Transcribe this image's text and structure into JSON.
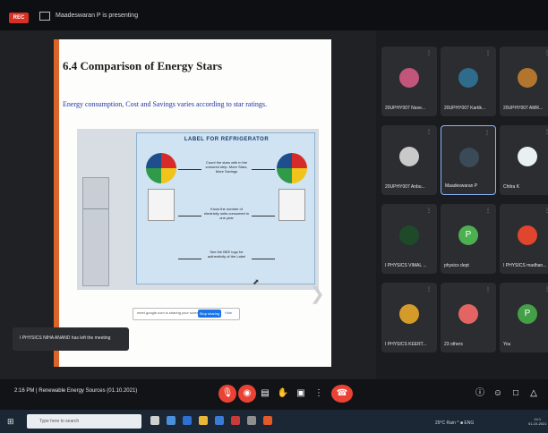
{
  "top": {
    "rec": "REC",
    "presenting": "Maadeswaran P is presenting"
  },
  "slide": {
    "title": "6.4 Comparison of Energy Stars",
    "subtitle": "Energy consumption, Cost and Savings varies according to star ratings.",
    "label_heading": "LABEL FOR REFRIGERATOR",
    "note1": "Count the stars with in the coloured strip. More Stars, More Savings",
    "note2": "Know the number of electricity units consumed in one year",
    "note3": "See the BEE logo for authenticity of the Label"
  },
  "share_bar": {
    "text": "meet.google.com is sharing your screen.",
    "stop": "Stop sharing",
    "hide": "Hide"
  },
  "toast": "I PHYSICS NIHA ANAND has left the meeting",
  "participants": [
    {
      "name": "20UPHY007 Nave...",
      "initial": "",
      "color": "#c2567a"
    },
    {
      "name": "20UPHY007 Kartik...",
      "initial": "",
      "color": "#2f6c8c"
    },
    {
      "name": "20UPHY007 AMR...",
      "initial": "",
      "color": "#b2752e"
    },
    {
      "name": "20UPHY007 Anbu...",
      "initial": "",
      "color": "#c9c9c9"
    },
    {
      "name": "Maadeswaran P",
      "initial": "",
      "color": "#3a4a56"
    },
    {
      "name": "Chitra K",
      "initial": "",
      "color": "#e8f0f4"
    },
    {
      "name": "I PHYSICS VIMAL ...",
      "initial": "",
      "color": "#1e4a2a"
    },
    {
      "name": "physics dept",
      "initial": "P",
      "color": "#4caf50"
    },
    {
      "name": "I PHYSICS madhan...",
      "initial": "",
      "color": "#e0452d"
    },
    {
      "name": "I PHYSICS KEERT...",
      "initial": "",
      "color": "#d59b2a"
    },
    {
      "name": "23 others",
      "initial": "",
      "color": "#e46464"
    },
    {
      "name": "You",
      "initial": "P",
      "color": "#43a047"
    }
  ],
  "bottom": {
    "time_label": "2:16 PM | Renewable Energy Sources (01.10.2021)"
  },
  "taskbar": {
    "search": "Type here to search",
    "tray": "29°C Rain ^ ■ ENG",
    "time": "14:1",
    "date": "01-10-2021"
  },
  "colors": {
    "accent_red": "#ea4335",
    "slide_bar": "#d9652a",
    "speaking": "#8ab4f8"
  }
}
